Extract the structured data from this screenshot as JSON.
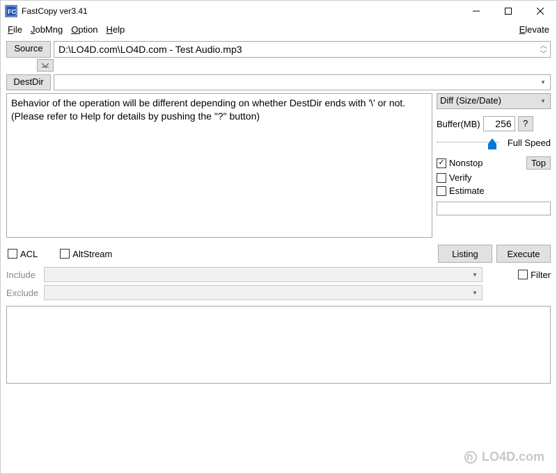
{
  "window": {
    "title": "FastCopy ver3.41"
  },
  "menu": {
    "file": "File",
    "jobmng": "JobMng",
    "option": "Option",
    "help": "Help",
    "elevate": "Elevate"
  },
  "buttons": {
    "source": "Source",
    "destdir": "DestDir",
    "listing": "Listing",
    "execute": "Execute",
    "top": "Top",
    "help_q": "?"
  },
  "fields": {
    "source_value": "D:\\LO4D.com\\LO4D.com - Test Audio.mp3",
    "dest_value": "",
    "buffer_label": "Buffer(MB)",
    "buffer_value": "256",
    "speed_label": "Full Speed"
  },
  "mode": {
    "selected": "Diff (Size/Date)"
  },
  "info": {
    "line1": "Behavior of the operation will be different depending on whether DestDir ends with '\\' or not.",
    "line2": "(Please refer to Help for details by pushing the \"?\" button)"
  },
  "checks": {
    "nonstop": "Nonstop",
    "verify": "Verify",
    "estimate": "Estimate",
    "acl": "ACL",
    "altstream": "AltStream",
    "filter": "Filter"
  },
  "filters": {
    "include_label": "Include",
    "exclude_label": "Exclude"
  },
  "watermark": "LO4D.com"
}
